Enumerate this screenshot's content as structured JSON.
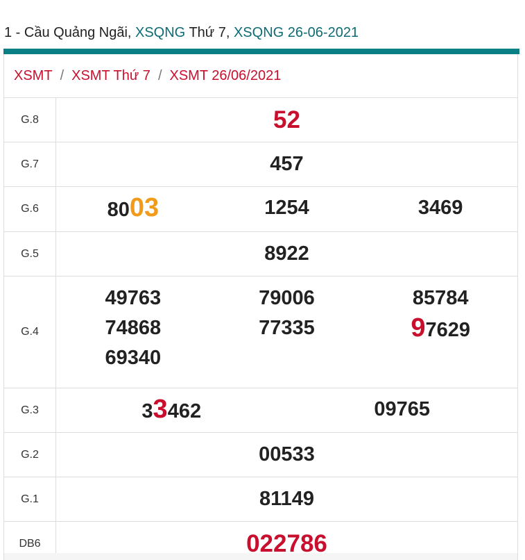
{
  "header": {
    "prefix": "1 - Cầu Quảng Ngãi, ",
    "link1": "XSQNG",
    "middle": " Thứ 7, ",
    "link2": "XSQNG 26-06-2021"
  },
  "breadcrumb": {
    "items": [
      "XSMT",
      "XSMT Thứ 7",
      "XSMT 26/06/2021"
    ],
    "separator": "/"
  },
  "colors": {
    "accent_teal": "#0a7f86",
    "link_teal": "#0c6b74",
    "red": "#c8102e",
    "orange": "#f29a1a"
  },
  "results": {
    "g8": {
      "label": "G.8",
      "value": "52"
    },
    "g7": {
      "label": "G.7",
      "value": "457"
    },
    "g6": {
      "label": "G.6",
      "n1_prefix": "80",
      "n1_hl": "03",
      "n2": "1254",
      "n3": "3469"
    },
    "g5": {
      "label": "G.5",
      "value": "8922"
    },
    "g4": {
      "label": "G.4",
      "c1": [
        "49763",
        "74868",
        "69340"
      ],
      "c2": [
        "79006",
        "77335"
      ],
      "c3_1": "85784",
      "c3_2_hl": "9",
      "c3_2_rest": "7629"
    },
    "g3": {
      "label": "G.3",
      "n1_a": "3",
      "n1_hl": "3",
      "n1_b": "462",
      "n2": "09765"
    },
    "g2": {
      "label": "G.2",
      "value": "00533"
    },
    "g1": {
      "label": "G.1",
      "value": "81149"
    },
    "db": {
      "label": "DB6",
      "value": "022786"
    }
  }
}
